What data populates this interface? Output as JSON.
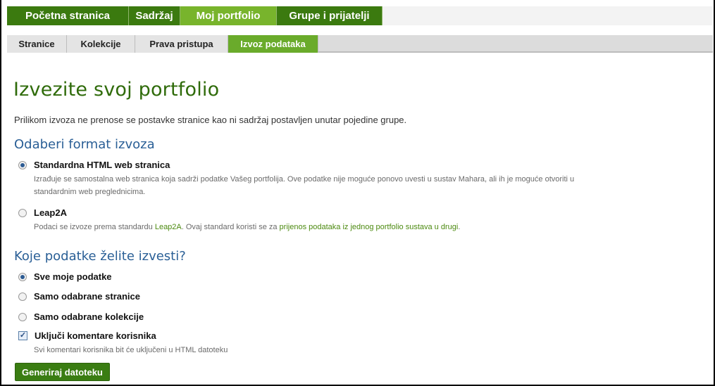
{
  "main_nav": {
    "items": [
      {
        "label": "Početna stranica",
        "active": false
      },
      {
        "label": "Sadržaj",
        "active": false
      },
      {
        "label": "Moj portfolio",
        "active": true
      },
      {
        "label": "Grupe i prijatelji",
        "active": false
      }
    ]
  },
  "sub_nav": {
    "items": [
      {
        "label": "Stranice",
        "active": false
      },
      {
        "label": "Kolekcije",
        "active": false
      },
      {
        "label": "Prava pristupa",
        "active": false
      },
      {
        "label": "Izvoz podataka",
        "active": true
      }
    ]
  },
  "page": {
    "title": "Izvezite svoj portfolio",
    "intro": "Prilikom izvoza ne prenose se postavke stranice kao ni sadržaj postavljen unutar pojedine grupe."
  },
  "format_section": {
    "heading": "Odaberi format izvoza",
    "options": [
      {
        "label": "Standardna HTML web stranica",
        "checked": true,
        "desc_line1": "Izrađuje se samostalna web stranica koja sadrži podatke Vašeg portfolija. Ove podatke nije moguće ponovo uvesti u sustav Mahara, ali ih je moguće otvoriti u",
        "desc_line2": "standardnim web preglednicima."
      },
      {
        "label": "Leap2A",
        "checked": false,
        "desc_pre": "Podaci se izvoze prema standardu ",
        "desc_link1": "Leap2A",
        "desc_mid": ". Ovaj standard koristi se za ",
        "desc_link2": "prijenos podataka iz jednog portfolio sustava u drugi",
        "desc_post": "."
      }
    ]
  },
  "data_section": {
    "heading": "Koje podatke želite izvesti?",
    "options": [
      {
        "label": "Sve moje podatke",
        "checked": true
      },
      {
        "label": "Samo odabrane stranice",
        "checked": false
      },
      {
        "label": "Samo odabrane kolekcije",
        "checked": false
      }
    ],
    "include_comments": {
      "label": "Uključi komentare korisnika",
      "checked": true,
      "desc": "Svi komentari korisnika bit će uključeni u HTML datoteku"
    }
  },
  "button": {
    "label": "Generiraj datoteku"
  },
  "colors": {
    "nav_green": "#3b7a0f",
    "nav_active_green": "#78b42c",
    "title_green": "#2f6b0a",
    "heading_blue": "#2a5f96",
    "link_green": "#4c8a10"
  }
}
